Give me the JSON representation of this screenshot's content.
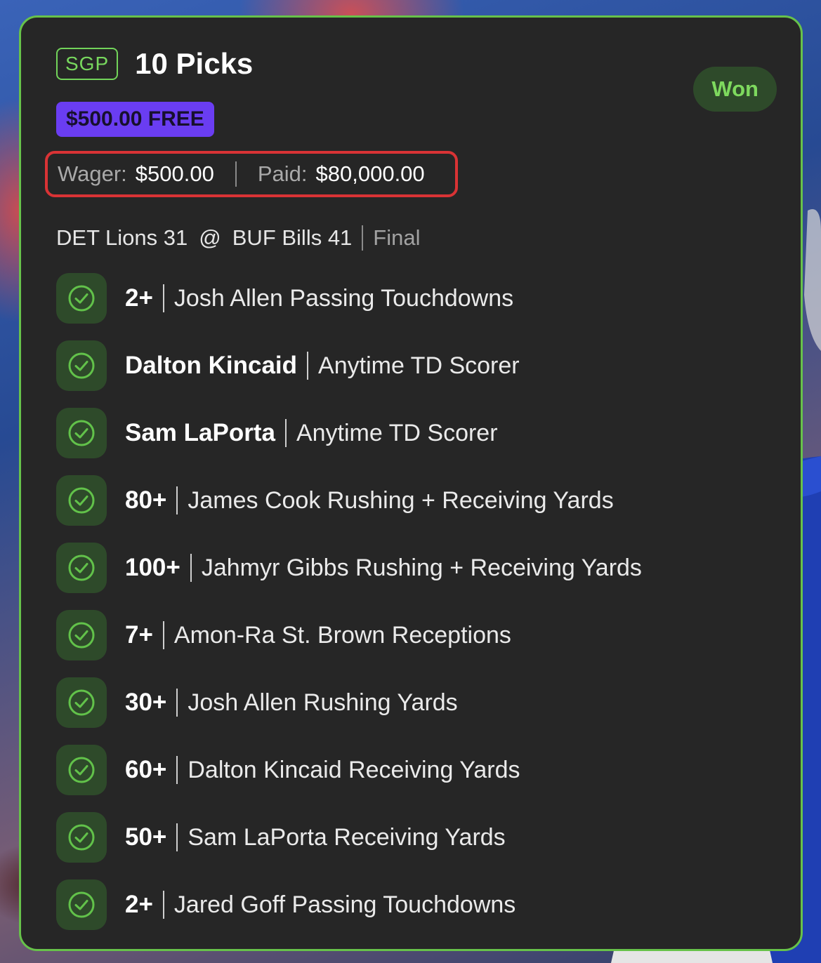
{
  "bet": {
    "type_badge": "SGP",
    "title": "10 Picks",
    "status": "Won",
    "bonus_tag": "$500.00 FREE",
    "wager_label": "Wager:",
    "wager_value": "$500.00",
    "paid_label": "Paid:",
    "paid_value": "$80,000.00"
  },
  "game": {
    "away": "DET Lions 31",
    "at": "@",
    "home": "BUF Bills 41",
    "status": "Final"
  },
  "picks": [
    {
      "main": "2+",
      "desc": "Josh Allen Passing Touchdowns"
    },
    {
      "main": "Dalton Kincaid",
      "desc": "Anytime TD Scorer"
    },
    {
      "main": "Sam LaPorta",
      "desc": "Anytime TD Scorer"
    },
    {
      "main": "80+",
      "desc": "James Cook Rushing + Receiving Yards"
    },
    {
      "main": "100+",
      "desc": "Jahmyr Gibbs Rushing + Receiving Yards"
    },
    {
      "main": "7+",
      "desc": "Amon-Ra St. Brown Receptions"
    },
    {
      "main": "30+",
      "desc": "Josh Allen Rushing Yards"
    },
    {
      "main": "60+",
      "desc": "Dalton Kincaid Receiving Yards"
    },
    {
      "main": "50+",
      "desc": "Sam LaPorta Receiving Yards"
    },
    {
      "main": "2+",
      "desc": "Jared Goff Passing Touchdowns"
    }
  ],
  "colors": {
    "accent_green": "#67c24a",
    "free_purple": "#6a3df2",
    "highlight_red": "#d93335",
    "card_bg": "#262626"
  },
  "icons": {
    "pick_status": "check-circle-icon"
  }
}
